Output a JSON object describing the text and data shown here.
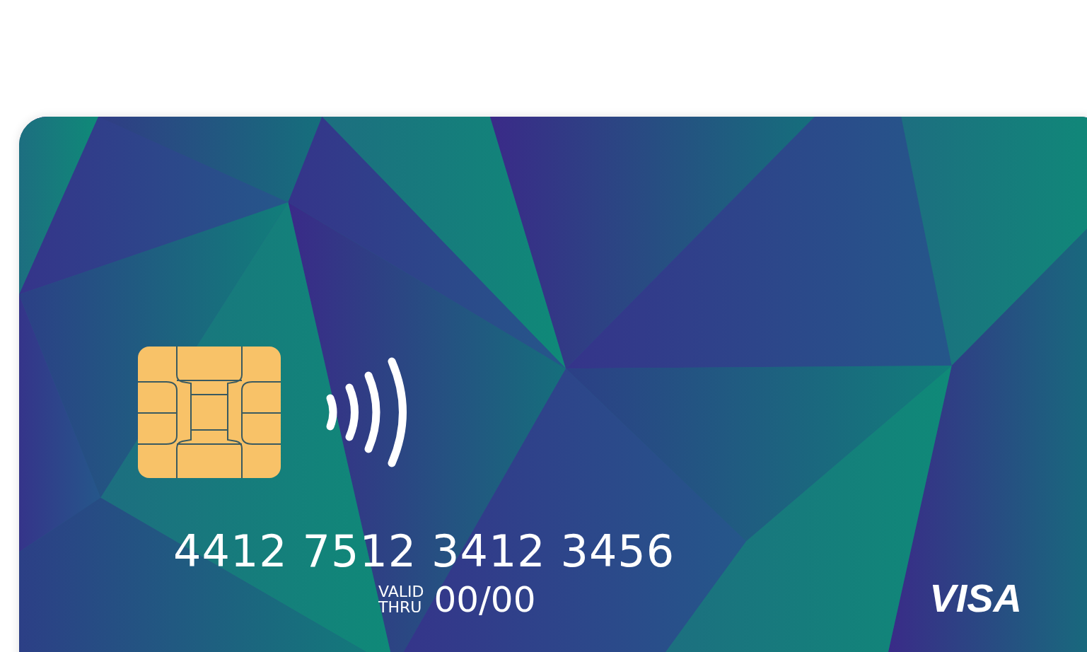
{
  "card": {
    "number": "4412 7512 3412 3456",
    "valid_thru_label": "VALID THRU",
    "expiry": "00/00",
    "brand": "VISA"
  }
}
